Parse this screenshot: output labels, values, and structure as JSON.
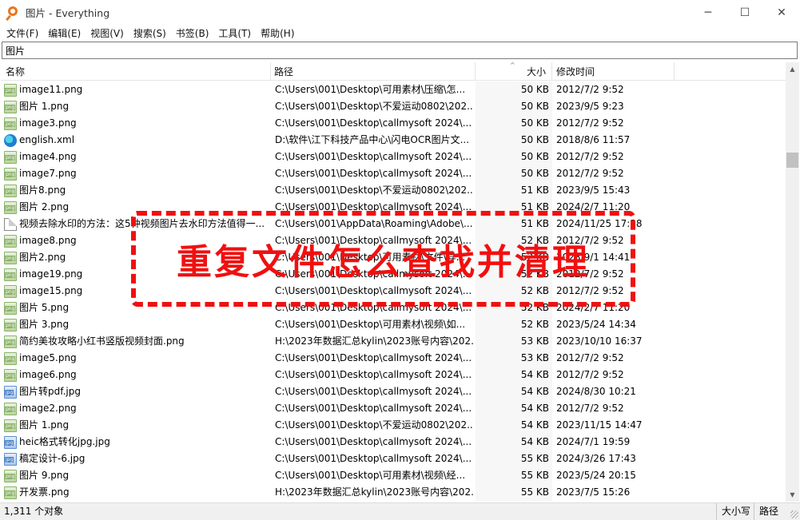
{
  "window": {
    "title": "图片 - Everything",
    "minimize_glyph": "─",
    "maximize_glyph": "☐",
    "close_glyph": "✕"
  },
  "menu": [
    "文件(F)",
    "编辑(E)",
    "视图(V)",
    "搜索(S)",
    "书签(B)",
    "工具(T)",
    "帮助(H)"
  ],
  "search": {
    "value": "图片"
  },
  "columns": {
    "name": "名称",
    "path": "路径",
    "size": "大小",
    "date": "修改时间"
  },
  "rows": [
    {
      "icon": "png",
      "name": "image11.png",
      "path": "C:\\Users\\001\\Desktop\\可用素材\\压缩\\怎...",
      "size": "50 KB",
      "date": "2012/7/2 9:52"
    },
    {
      "icon": "png",
      "name": "图片 1.png",
      "path": "C:\\Users\\001\\Desktop\\不爱运动0802\\202...",
      "size": "50 KB",
      "date": "2023/9/5 9:23"
    },
    {
      "icon": "png",
      "name": "image3.png",
      "path": "C:\\Users\\001\\Desktop\\callmysoft 2024\\...",
      "size": "50 KB",
      "date": "2012/7/2 9:52"
    },
    {
      "icon": "xml",
      "name": "english.xml",
      "path": "D:\\软件\\江下科技产品中心\\闪电OCR图片文...",
      "size": "50 KB",
      "date": "2018/8/6 11:57"
    },
    {
      "icon": "png",
      "name": "image4.png",
      "path": "C:\\Users\\001\\Desktop\\callmysoft 2024\\...",
      "size": "50 KB",
      "date": "2012/7/2 9:52"
    },
    {
      "icon": "png",
      "name": "image7.png",
      "path": "C:\\Users\\001\\Desktop\\callmysoft 2024\\...",
      "size": "50 KB",
      "date": "2012/7/2 9:52"
    },
    {
      "icon": "png",
      "name": "图片8.png",
      "path": "C:\\Users\\001\\Desktop\\不爱运动0802\\202...",
      "size": "51 KB",
      "date": "2023/9/5 15:43"
    },
    {
      "icon": "png",
      "name": "图片 2.png",
      "path": "C:\\Users\\001\\Desktop\\callmysoft 2024\\...",
      "size": "51 KB",
      "date": "2024/2/7 11:20"
    },
    {
      "icon": "txt",
      "name": "视频去除水印的方法：这5种视频图片去水印方法值得一...",
      "path": "C:\\Users\\001\\AppData\\Roaming\\Adobe\\...",
      "size": "51 KB",
      "date": "2024/11/25 17:38"
    },
    {
      "icon": "png",
      "name": "image8.png",
      "path": "C:\\Users\\001\\Desktop\\callmysoft 2024\\...",
      "size": "52 KB",
      "date": "2012/7/2 9:52"
    },
    {
      "icon": "png",
      "name": "图片2.png",
      "path": "C:\\Users\\001\\Desktop\\可用素材\\文件\\异...",
      "size": "52 KB",
      "date": "2023/9/1 14:41"
    },
    {
      "icon": "png",
      "name": "image19.png",
      "path": "C:\\Users\\001\\Desktop\\callmysoft 2024\\...",
      "size": "52 KB",
      "date": "2012/7/2 9:52"
    },
    {
      "icon": "png",
      "name": "image15.png",
      "path": "C:\\Users\\001\\Desktop\\callmysoft 2024\\...",
      "size": "52 KB",
      "date": "2012/7/2 9:52"
    },
    {
      "icon": "png",
      "name": "图片 5.png",
      "path": "C:\\Users\\001\\Desktop\\callmysoft 2024\\...",
      "size": "52 KB",
      "date": "2024/2/7 11:20"
    },
    {
      "icon": "png",
      "name": "图片 3.png",
      "path": "C:\\Users\\001\\Desktop\\可用素材\\视频\\如...",
      "size": "52 KB",
      "date": "2023/5/24 14:34"
    },
    {
      "icon": "png",
      "name": "简约美妆攻略小红书竖版视频封面.png",
      "path": "H:\\2023年数据汇总kylin\\2023账号内容\\202...",
      "size": "53 KB",
      "date": "2023/10/10 16:37"
    },
    {
      "icon": "png",
      "name": "image5.png",
      "path": "C:\\Users\\001\\Desktop\\callmysoft 2024\\...",
      "size": "53 KB",
      "date": "2012/7/2 9:52"
    },
    {
      "icon": "png",
      "name": "image6.png",
      "path": "C:\\Users\\001\\Desktop\\callmysoft 2024\\...",
      "size": "54 KB",
      "date": "2012/7/2 9:52"
    },
    {
      "icon": "jpg",
      "name": "图片转pdf.jpg",
      "path": "C:\\Users\\001\\Desktop\\callmysoft 2024\\...",
      "size": "54 KB",
      "date": "2024/8/30 10:21"
    },
    {
      "icon": "png",
      "name": "image2.png",
      "path": "C:\\Users\\001\\Desktop\\callmysoft 2024\\...",
      "size": "54 KB",
      "date": "2012/7/2 9:52"
    },
    {
      "icon": "png",
      "name": "图片 1.png",
      "path": "C:\\Users\\001\\Desktop\\不爱运动0802\\202...",
      "size": "54 KB",
      "date": "2023/11/15 14:47"
    },
    {
      "icon": "jpg",
      "name": "heic格式转化jpg.jpg",
      "path": "C:\\Users\\001\\Desktop\\callmysoft 2024\\...",
      "size": "54 KB",
      "date": "2024/7/1 19:59"
    },
    {
      "icon": "jpg",
      "name": "稿定设计-6.jpg",
      "path": "C:\\Users\\001\\Desktop\\callmysoft 2024\\...",
      "size": "55 KB",
      "date": "2024/3/26 17:43"
    },
    {
      "icon": "png",
      "name": "图片 9.png",
      "path": "C:\\Users\\001\\Desktop\\可用素材\\视频\\经...",
      "size": "55 KB",
      "date": "2023/5/24 20:15"
    },
    {
      "icon": "png",
      "name": "开发票.png",
      "path": "H:\\2023年数据汇总kylin\\2023账号内容\\202...",
      "size": "55 KB",
      "date": "2023/7/5 15:26"
    }
  ],
  "status": {
    "count": "1,311 个对象",
    "match_case": "大小写",
    "match_path": "路径"
  },
  "overlay": {
    "text": "重复文件怎么查找并清理",
    "color": "#f01010"
  }
}
